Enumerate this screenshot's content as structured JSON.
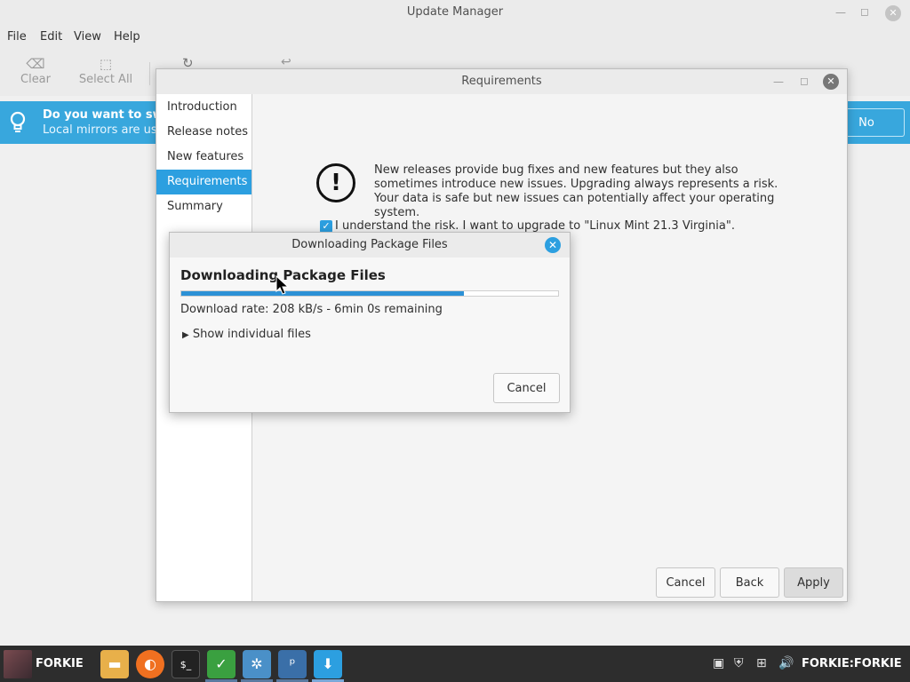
{
  "main_window": {
    "title": "Update Manager",
    "menu": [
      "File",
      "Edit",
      "View",
      "Help"
    ],
    "toolbar": {
      "clear_label": "Clear",
      "select_all_label": "Select All"
    },
    "infobar": {
      "title": "Do you want to swit",
      "subtitle": "Local mirrors are usu",
      "no_label": "No"
    }
  },
  "requirements_dialog": {
    "title": "Requirements",
    "sidebar": [
      "Introduction",
      "Release notes",
      "New features",
      "Requirements",
      "Summary"
    ],
    "active_index": 3,
    "warning_text": "New releases provide bug fixes and new features but they also sometimes introduce new issues. Upgrading always represents a risk. Your data is safe but new issues can potentially affect your operating system.",
    "risk_checkbox_label": "I understand the risk. I want to upgrade to \"Linux Mint 21.3 Virginia\".",
    "risk_checked": true,
    "buttons": {
      "cancel": "Cancel",
      "back": "Back",
      "apply": "Apply"
    }
  },
  "download_dialog": {
    "title": "Downloading Package Files",
    "heading": "Downloading Package Files",
    "progress_fraction": 0.75,
    "rate_text": "Download rate: 208 kB/s - 6min 0s remaining",
    "show_files_label": "Show individual files",
    "cancel_label": "Cancel"
  },
  "taskbar": {
    "start_label": "FORKIE",
    "user_label": "FORKIE:FORKIE",
    "apps": [
      "files-icon",
      "firefox-icon",
      "terminal-icon",
      "shield-icon",
      "settings-icon",
      "python-icon",
      "update-manager-icon"
    ],
    "tray": [
      "clipboard-icon",
      "security-icon",
      "network-icon",
      "volume-icon"
    ]
  },
  "colors": {
    "accent": "#2c9fe0",
    "infobar": "#38a7dd",
    "taskbar": "#2d2d2d"
  }
}
